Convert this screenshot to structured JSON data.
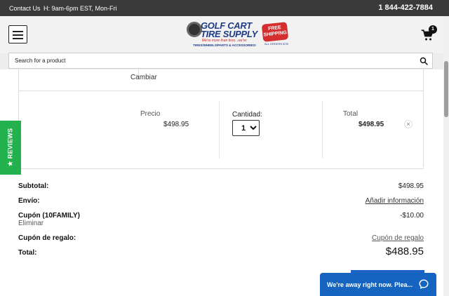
{
  "topbar": {
    "contact": "Contact Us",
    "hours": "H: 9am-6pm EST, Mon-Fri",
    "phone": "1 844-422-7884"
  },
  "header": {
    "logo_line1": "GOLF CART",
    "logo_line2": "TIRE SUPPLY",
    "logo_tagline": "We're more than tires...we're:",
    "logo_sub": "TIRES/WHEELS/PARTS & ACCESSORIES!",
    "free_badge_line1": "FREE",
    "free_badge_line2": "SHIPPING",
    "free_badge_sub": "ALL ORDERS $75!",
    "cart_count": "1"
  },
  "search": {
    "placeholder": "Search for a product"
  },
  "cart_item": {
    "change_label": "Cambiar",
    "price_label": "Precio",
    "price_value": "$498.95",
    "quantity_label": "Cantidad:",
    "quantity_value": "1",
    "total_label": "Total",
    "total_value": "$498.95",
    "remove_glyph": "×"
  },
  "summary": {
    "subtotal_label": "Subtotal:",
    "subtotal_value": "$498.95",
    "shipping_label": "Envío:",
    "shipping_link": "Añadir información",
    "coupon_label": "Cupón (10FAMILY)",
    "coupon_value": "-$10.00",
    "coupon_remove": "Eliminar",
    "gift_label": "Cupón de regalo:",
    "gift_link": "Cupón de regalo",
    "total_label": "Total:",
    "total_value": "$488.95"
  },
  "reviews_tab": {
    "label": "★ REVIEWS"
  },
  "chat": {
    "label": "We're away right now. Plea..."
  },
  "colors": {
    "topbar": "#3a3a3a",
    "reviews": "#22b14c",
    "chat": "#1565c0",
    "logo_blue": "#1d3b87",
    "logo_red": "#d32f2f"
  }
}
